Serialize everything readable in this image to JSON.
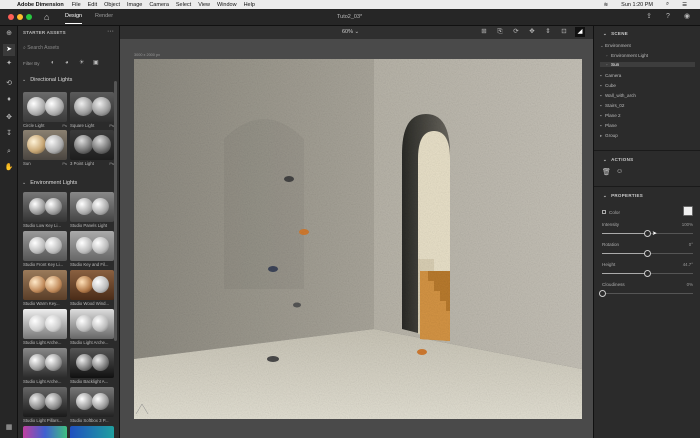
{
  "menubar": {
    "app": "Adobe Dimension",
    "items": [
      "File",
      "Edit",
      "Object",
      "Image",
      "Camera",
      "Select",
      "View",
      "Window",
      "Help"
    ],
    "clock": "Sun 1:20 PM"
  },
  "titlebar": {
    "tabs": [
      "Design",
      "Render"
    ],
    "active_tab": "Design",
    "doc_title": "Tuto2_03*"
  },
  "assets": {
    "header": "STARTER ASSETS",
    "search_placeholder": "Search Assets",
    "filter_label": "Filter By",
    "directional": {
      "title": "Directional Lights",
      "items": [
        {
          "label": "Circle Light",
          "badge": "Ps"
        },
        {
          "label": "Square Light",
          "badge": "Ps"
        },
        {
          "label": "Sun",
          "badge": "Ps"
        },
        {
          "label": "3 Point Light",
          "badge": "Ps"
        }
      ]
    },
    "environment": {
      "title": "Environment Lights",
      "items": [
        {
          "label": "Studio Low Key Li..."
        },
        {
          "label": "Studio Panels Light"
        },
        {
          "label": "Studio Front Key Li..."
        },
        {
          "label": "Studio Key and Fil..."
        },
        {
          "label": "Studio Warm Key..."
        },
        {
          "label": "Studio Wood Wind..."
        },
        {
          "label": "Studio Light Arche..."
        },
        {
          "label": "Studio Light Arche..."
        },
        {
          "label": "Studio Light Arche..."
        },
        {
          "label": "Studio Backlight A..."
        },
        {
          "label": "Studio Light Pillars..."
        },
        {
          "label": "Studio Softbox 3 P..."
        }
      ]
    }
  },
  "viewport": {
    "zoom": "60%",
    "canvas_size": "3000 x 2000 px"
  },
  "scene": {
    "title": "SCENE",
    "layers": [
      "Environment",
      "Environment Light",
      "Sun",
      "Camera",
      "Cube",
      "Wall_with_arch",
      "Stairs_02",
      "Plane 2",
      "Plane",
      "Group"
    ],
    "selected": "Sun"
  },
  "actions": {
    "title": "ACTIONS"
  },
  "properties": {
    "title": "PROPERTIES",
    "color_label": "Color",
    "intensity": {
      "label": "Intensity",
      "value": "100%",
      "fraction": 0.5
    },
    "rotation": {
      "label": "Rotation",
      "value": "0°",
      "fraction": 0.5
    },
    "height": {
      "label": "Height",
      "value": "44.7°",
      "fraction": 0.5
    },
    "cloudiness": {
      "label": "Cloudiness",
      "value": "0%",
      "fraction": 0
    }
  }
}
